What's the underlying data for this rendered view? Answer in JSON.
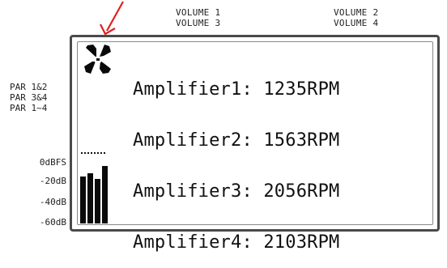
{
  "volumes": {
    "left_line1": "VOLUME 1",
    "left_line2": "VOLUME 3",
    "right_line1": "VOLUME 2",
    "right_line2": "VOLUME 4"
  },
  "par_labels": [
    "PAR 1&2",
    "PAR 3&4",
    "PAR 1~4"
  ],
  "db_scale": [
    "0dBFS",
    "-20dB",
    "-40dB",
    "-60dB"
  ],
  "display": {
    "fan_icon": "fan-icon",
    "amplifiers": [
      {
        "label": "Amplifier1:",
        "rpm": "1235RPM"
      },
      {
        "label": "Amplifier2:",
        "rpm": "1563RPM"
      },
      {
        "label": "Amplifier3:",
        "rpm": "2056RPM"
      },
      {
        "label": "Amplifier4:",
        "rpm": "2103RPM"
      }
    ]
  },
  "meter": {
    "levels": [
      0.67,
      0.72,
      0.64,
      0.82
    ],
    "peak_marker": "dotted"
  },
  "colors": {
    "arrow": "#e02020",
    "lcd_text": "#111111",
    "frame": "#4a4a4a"
  }
}
